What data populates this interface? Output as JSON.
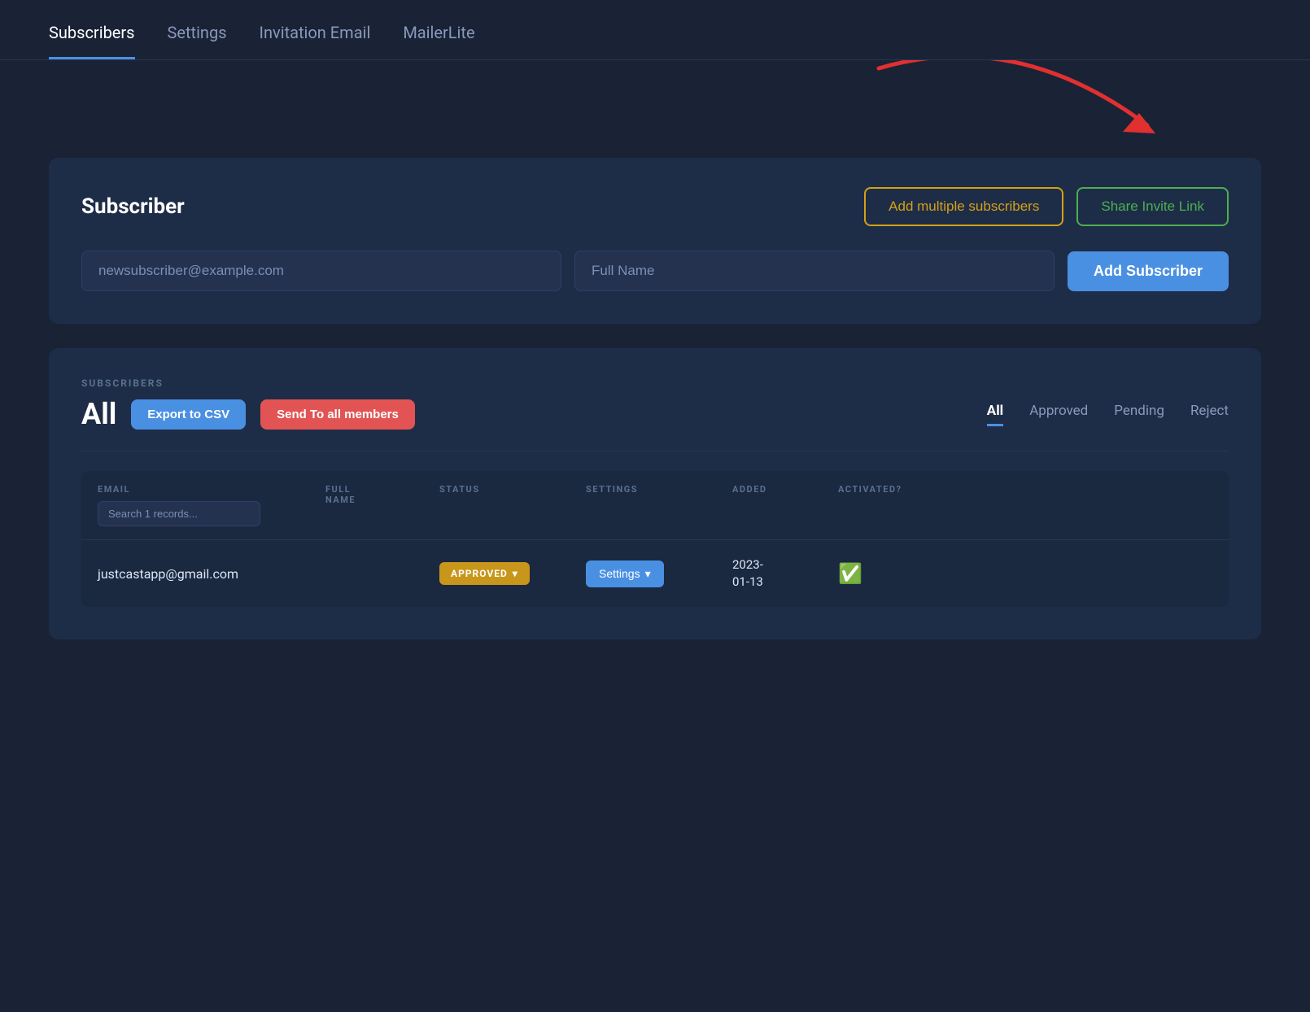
{
  "nav": {
    "tabs": [
      {
        "label": "Subscribers",
        "active": true
      },
      {
        "label": "Settings",
        "active": false
      },
      {
        "label": "Invitation Email",
        "active": false
      },
      {
        "label": "MailerLite",
        "active": false
      }
    ]
  },
  "subscriber_card": {
    "title": "Subscriber",
    "btn_multiple": "Add multiple subscribers",
    "btn_invite": "Share Invite Link",
    "email_placeholder": "newsubscriber@example.com",
    "name_placeholder": "Full Name",
    "add_btn": "Add Subscriber"
  },
  "subscribers_section": {
    "section_label": "SUBSCRIBERS",
    "all_label": "All",
    "export_btn": "Export to CSV",
    "send_btn": "Send To all members",
    "filter_tabs": [
      {
        "label": "All",
        "active": true
      },
      {
        "label": "Approved",
        "active": false
      },
      {
        "label": "Pending",
        "active": false
      },
      {
        "label": "Reject",
        "active": false
      }
    ],
    "table": {
      "columns": [
        {
          "label": "EMAIL"
        },
        {
          "label": "FULL\nNAME"
        },
        {
          "label": "STATUS"
        },
        {
          "label": "SETTINGS"
        },
        {
          "label": "ADDED"
        },
        {
          "label": "ACTIVATED?"
        }
      ],
      "search_placeholder": "Search 1 records...",
      "rows": [
        {
          "email": "justcastapp@gmail.com",
          "full_name": "",
          "status": "APPROVED",
          "settings": "Settings",
          "added": "2023-01-13",
          "activated": true
        }
      ]
    }
  }
}
